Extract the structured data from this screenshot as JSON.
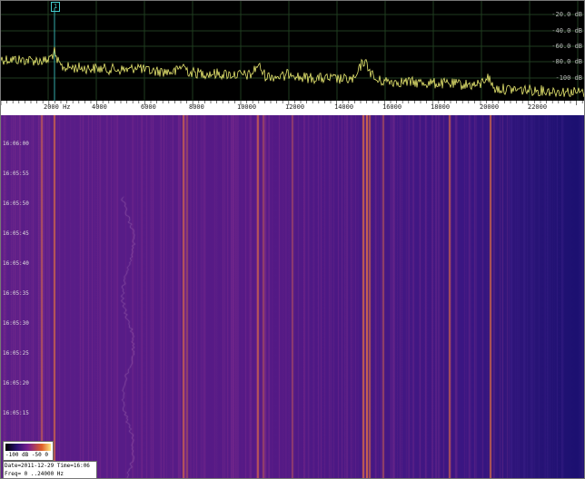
{
  "spectrum": {
    "db_levels": [
      "-20.0 dB",
      "-40.0 dB",
      "-60.0 dB",
      "-80.0 dB",
      "-100 dB"
    ],
    "marker_label": "1",
    "trace_color": "#e8e870",
    "grid_color": "#1f3d1f"
  },
  "freq_axis": {
    "labels": [
      "2000 Hz",
      "4000",
      "6000",
      "8000",
      "10000",
      "12000",
      "14000",
      "16000",
      "18000",
      "20000",
      "22000"
    ]
  },
  "waterfall": {
    "time_labels": [
      "16:06:00",
      "16:05:55",
      "16:05:50",
      "16:05:45",
      "16:05:40",
      "16:05:35",
      "16:05:30",
      "16:05:25",
      "16:05:20",
      "16:05:15"
    ]
  },
  "legend": {
    "scale_labels": "-100 dB  -50   0"
  },
  "info": {
    "date_line": "Date=2011-12-29 Time=16:06",
    "freq_line": "Freq= 0 ..24000 Hz"
  }
}
